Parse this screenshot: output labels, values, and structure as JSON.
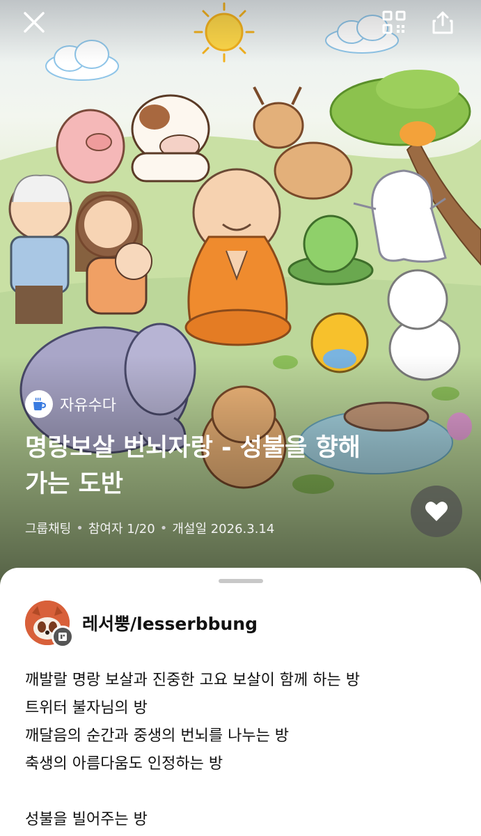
{
  "header": {
    "close_icon": "close-icon",
    "qr_icon": "qr-code-icon",
    "share_icon": "share-icon"
  },
  "hero": {
    "category_label": "자유수다",
    "category_icon": "coffee-cup-icon",
    "title": "명랑보살 번뇌자랑 - 성불을 향해가는 도반",
    "meta": {
      "type": "그룹채팅",
      "participants": "참여자 1/20",
      "opened": "개설일 2026.3.14"
    },
    "like_icon": "heart-icon"
  },
  "owner": {
    "name": "레서뿡/lesserbbung"
  },
  "description": {
    "lines": [
      "깨발랄 명랑 보살과 진중한 고요 보살이 함께 하는 방",
      "트위터 불자님의 방",
      "깨달음의 순간과 중생의 번뇌를 나누는 방",
      "축생의 아름다움도 인정하는 방",
      "",
      "성불을 빌어주는 방"
    ]
  },
  "colors": {
    "sheet_bg": "#ffffff",
    "category_icon": "#3a7be0",
    "avatar": "#d8603a"
  }
}
